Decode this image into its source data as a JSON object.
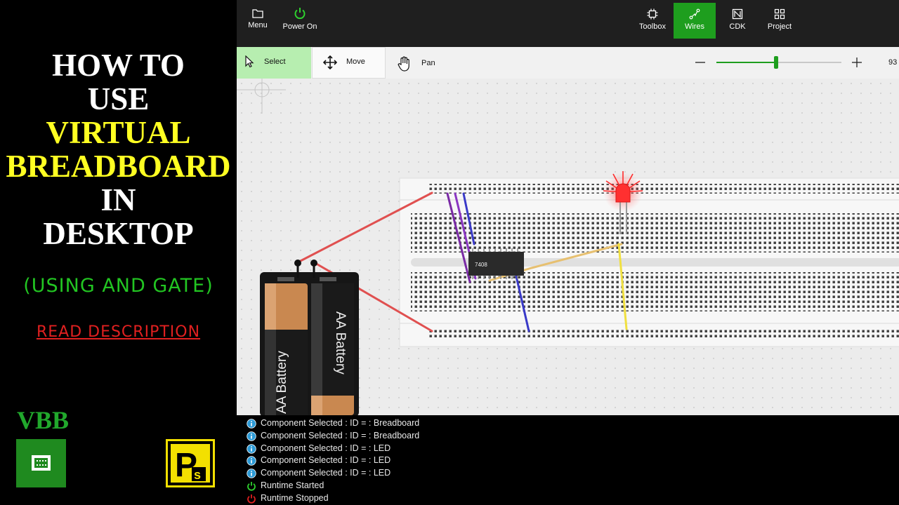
{
  "thumbnail": {
    "title_lines": [
      "HOW TO",
      "USE",
      "VIRTUAL",
      "BREADBOARD",
      "IN",
      "DESKTOP"
    ],
    "subtitle": "(USING AND GATE)",
    "note": "READ DESCRIPTION",
    "brand": "VBB",
    "ps_logo_text": "PS",
    "colors": {
      "white": "#ffffff",
      "yellow": "#ffff22",
      "green": "#22c522",
      "red": "#e02020"
    }
  },
  "app": {
    "top_bar": {
      "left": [
        {
          "label": "Menu",
          "icon": "folder-icon"
        },
        {
          "label": "Power On",
          "icon": "power-icon"
        }
      ],
      "right": [
        {
          "label": "Toolbox",
          "icon": "chip-icon"
        },
        {
          "label": "Wires",
          "icon": "wire-icon",
          "active": true
        },
        {
          "label": "CDK",
          "icon": "cdk-icon"
        },
        {
          "label": "Project",
          "icon": "grid-icon"
        }
      ]
    },
    "command_bar": {
      "select_label": "Select",
      "move_label": "Move",
      "pan_label": "Pan",
      "zoom_value": "93",
      "zoom_fraction": 0.48
    },
    "canvas": {
      "chip_label": "7408",
      "battery_label": "AA Battery",
      "led_color": "#ff2020"
    },
    "log": [
      {
        "icon": "info-icon",
        "text": "Component Selected : ID =  : Breadboard"
      },
      {
        "icon": "info-icon",
        "text": "Component Selected : ID =  : Breadboard"
      },
      {
        "icon": "info-icon",
        "text": "Component Selected : ID =  : LED"
      },
      {
        "icon": "info-icon",
        "text": "Component Selected : ID =  : LED"
      },
      {
        "icon": "info-icon",
        "text": "Component Selected : ID =  : LED"
      },
      {
        "icon": "power-on-icon",
        "text": "Runtime Started"
      },
      {
        "icon": "power-off-icon",
        "text": "Runtime Stopped"
      }
    ],
    "accent": "#1e9e1e"
  }
}
